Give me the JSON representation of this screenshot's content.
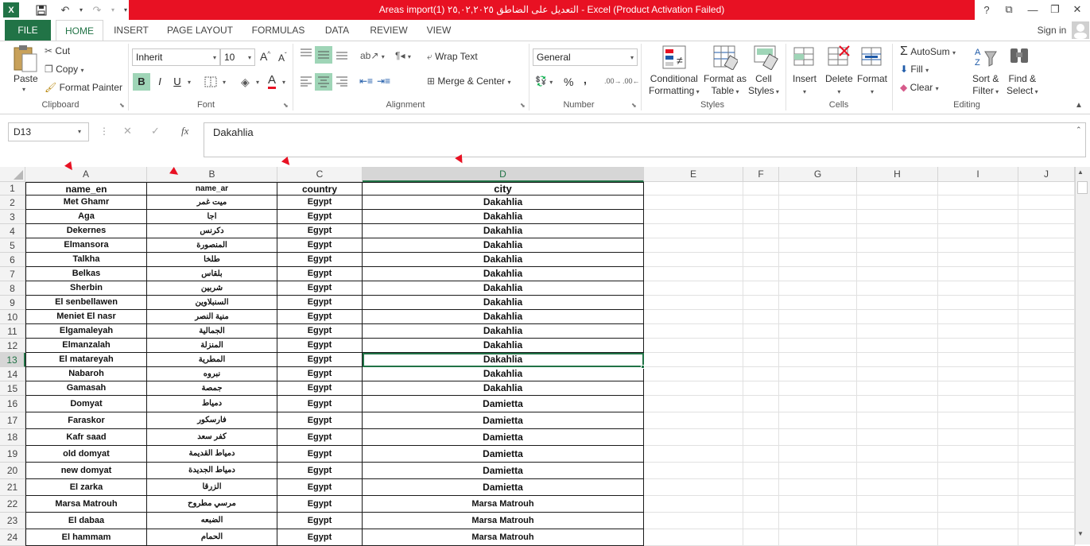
{
  "window": {
    "title": "Areas import(1) التعديل على الضاطق ٢٥,٠٢,٢٠٢٥ -  Excel (Product Activation Failed)",
    "help": "?",
    "restore_ribbon": "⧉",
    "minimize": "—",
    "maximize": "❐",
    "close": "✕"
  },
  "tabs": [
    "FILE",
    "HOME",
    "INSERT",
    "PAGE LAYOUT",
    "FORMULAS",
    "DATA",
    "REVIEW",
    "VIEW"
  ],
  "signin": "Sign in",
  "ribbon": {
    "clipboard": {
      "label": "Clipboard",
      "paste": "Paste",
      "cut": "Cut",
      "copy": "Copy",
      "format_painter": "Format Painter"
    },
    "font": {
      "label": "Font",
      "name": "Inherit",
      "size": "10",
      "bold": "B",
      "italic": "I",
      "underline": "U",
      "grow": "A",
      "shrink": "A"
    },
    "alignment": {
      "label": "Alignment",
      "wrap_text": "Wrap Text",
      "merge_center": "Merge & Center"
    },
    "number": {
      "label": "Number",
      "format": "General",
      "percent": "%",
      "comma": ","
    },
    "styles": {
      "label": "Styles",
      "conditional": "Conditional",
      "conditional2": "Formatting",
      "format_table": "Format as",
      "format_table2": "Table",
      "cell_styles": "Cell",
      "cell_styles2": "Styles"
    },
    "cells": {
      "label": "Cells",
      "insert": "Insert",
      "delete": "Delete",
      "format": "Format"
    },
    "editing": {
      "label": "Editing",
      "autosum": "AutoSum",
      "fill": "Fill",
      "clear": "Clear",
      "sort": "Sort &",
      "sort2": "Filter",
      "find": "Find &",
      "find2": "Select"
    }
  },
  "formula_bar": {
    "name_box": "D13",
    "fx": "fx",
    "value": "Dakahlia"
  },
  "columns": [
    "A",
    "B",
    "C",
    "D",
    "E",
    "F",
    "G",
    "H",
    "I",
    "J"
  ],
  "rows": [
    [
      "name_en",
      "name_ar",
      "country",
      "city"
    ],
    [
      "Met Ghamr",
      "ميت غمر",
      "Egypt",
      "Dakahlia"
    ],
    [
      "Aga",
      "اجا",
      "Egypt",
      "Dakahlia"
    ],
    [
      "Dekernes",
      "دكرنس",
      "Egypt",
      "Dakahlia"
    ],
    [
      "Elmansora",
      "المنصورة",
      "Egypt",
      "Dakahlia"
    ],
    [
      "Talkha",
      "طلخا",
      "Egypt",
      "Dakahlia"
    ],
    [
      "Belkas",
      "بلقاس",
      "Egypt",
      "Dakahlia"
    ],
    [
      "Sherbin",
      "شربين",
      "Egypt",
      "Dakahlia"
    ],
    [
      "El senbellawen",
      "السنبلاوين",
      "Egypt",
      "Dakahlia"
    ],
    [
      "Meniet El nasr",
      "منية النصر",
      "Egypt",
      "Dakahlia"
    ],
    [
      "Elgamaleyah",
      "الجمالية",
      "Egypt",
      "Dakahlia"
    ],
    [
      "Elmanzalah",
      "المنزلة",
      "Egypt",
      "Dakahlia"
    ],
    [
      "El matareyah",
      "المطرية",
      "Egypt",
      "Dakahlia"
    ],
    [
      "Nabaroh",
      "نبروه",
      "Egypt",
      "Dakahlia"
    ],
    [
      "Gamasah",
      "جمصة",
      "Egypt",
      "Dakahlia"
    ],
    [
      "Domyat",
      "دمياط",
      "Egypt",
      "Damietta"
    ],
    [
      "Faraskor",
      "فارسكور",
      "Egypt",
      "Damietta"
    ],
    [
      "Kafr saad",
      "كفر سعد",
      "Egypt",
      "Damietta"
    ],
    [
      "old domyat",
      "دمياط القديمة",
      "Egypt",
      "Damietta"
    ],
    [
      "new domyat",
      "دمياط الجديدة",
      "Egypt",
      "Damietta"
    ],
    [
      "El zarka",
      "الزرقا",
      "Egypt",
      "Damietta"
    ],
    [
      "Marsa Matrouh",
      "مرسي مطروح",
      "Egypt",
      "Marsa Matrouh"
    ],
    [
      "El dabaa",
      "الضبعه",
      "Egypt",
      "Marsa Matrouh"
    ],
    [
      "El hammam",
      "الحمام",
      "Egypt",
      "Marsa Matrouh"
    ]
  ],
  "colors": {
    "excel_green": "#217346",
    "title_red": "#e81123",
    "annotation_red": "#e81123"
  }
}
